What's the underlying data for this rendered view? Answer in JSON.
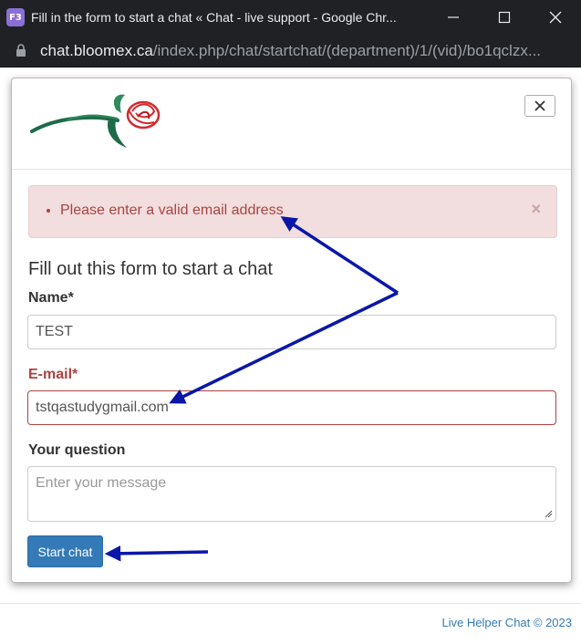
{
  "window": {
    "app_icon_text": "F3",
    "title": "Fill in the form to start a chat « Chat - live support - Google Chr..."
  },
  "address": {
    "host": "chat.bloomex.ca",
    "path": "/index.php/chat/startchat/(department)/1/(vid)/bo1qclzx..."
  },
  "alert": {
    "message": "Please enter a valid email address",
    "close_label": "×"
  },
  "form": {
    "title": "Fill out this form to start a chat",
    "name_label": "Name",
    "name_required": "*",
    "name_value": "TEST",
    "email_label": "E-mail",
    "email_required": "*",
    "email_value": "tstqastudygmail.com",
    "question_label": "Your question",
    "question_placeholder": "Enter your message",
    "submit_label": "Start chat"
  },
  "footer": {
    "text": "Live Helper Chat © 2023"
  },
  "colors": {
    "error_text": "#a94442",
    "error_bg": "#f2dede",
    "button": "#337ab7",
    "annotation_arrow": "#0a17a8"
  }
}
